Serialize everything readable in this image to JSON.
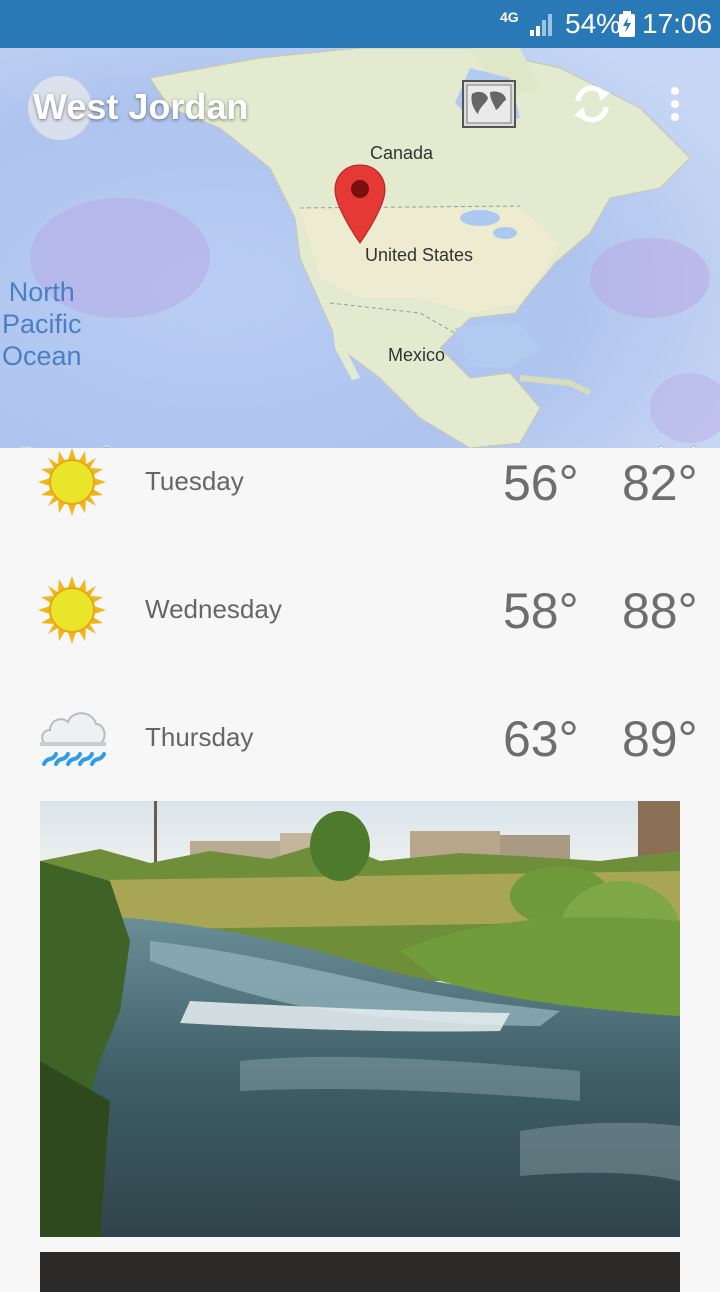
{
  "status_bar": {
    "network": "4G",
    "battery": "54%",
    "time": "17:06"
  },
  "header": {
    "city": "West Jordan"
  },
  "map": {
    "labels": {
      "canada": "Canada",
      "united_states": "United States",
      "mexico": "Mexico",
      "ocean_line1": "North",
      "ocean_line2": "Pacific",
      "ocean_line3": "Ocean"
    },
    "google": "Google",
    "layer": "wind"
  },
  "forecast": [
    {
      "day": "Tuesday",
      "low": "56°",
      "high": "82°",
      "icon": "sun-icon"
    },
    {
      "day": "Wednesday",
      "low": "58°",
      "high": "88°",
      "icon": "sun-icon"
    },
    {
      "day": "Thursday",
      "low": "63°",
      "high": "89°",
      "icon": "rain-cloud-icon"
    }
  ],
  "colors": {
    "status_bar": "#2a79b7",
    "temp_text": "#6e6e6e",
    "pin": "#e53935"
  }
}
